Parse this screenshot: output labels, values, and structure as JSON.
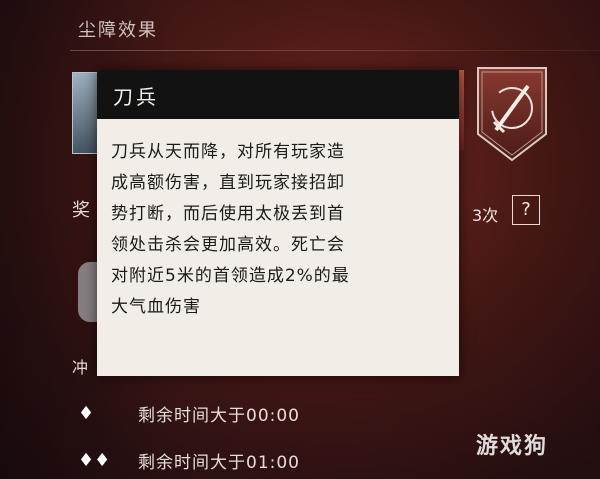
{
  "section": {
    "title": "尘障效果"
  },
  "left": {
    "label_top": "奖",
    "label_bottom": "冲"
  },
  "badge": {
    "icon": "sword-rune-icon"
  },
  "uses": {
    "count_label": "3次",
    "help_label": "?"
  },
  "tooltip": {
    "title": "刀兵",
    "lines": [
      "刀兵从天而降，对所有玩家造",
      "成高额伤害，直到玩家接招卸",
      "势打断，而后使用太极丢到首",
      "领处击杀会更加高效。死亡会",
      "对附近5米的首领造成2%的最",
      "大气血伤害"
    ]
  },
  "conditions": [
    {
      "icon": "♦",
      "text": "剩余时间大于00:00"
    },
    {
      "icon": "♦♦",
      "text": "剩余时间大于01:00"
    }
  ],
  "watermark": "游戏狗"
}
